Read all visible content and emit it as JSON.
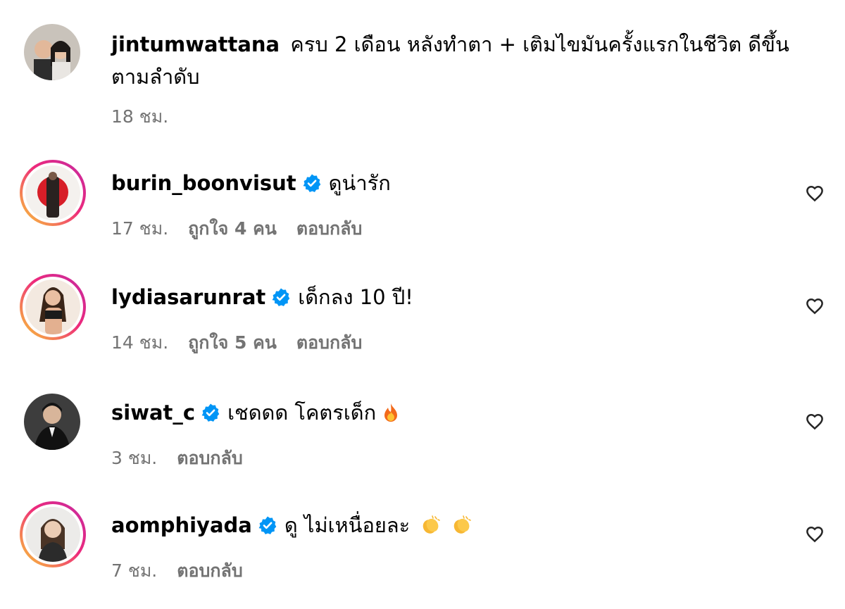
{
  "caption": {
    "username": "jintumwattana",
    "text": "ครบ 2 เดือน หลังทำตา + เติมไขมันครั้งแรกในชีวิต ดีขึ้นตามลำดับ",
    "time": "18 ชม."
  },
  "comments": [
    {
      "username": "burin_boonvisut",
      "verified": true,
      "text": "ดูน่ารัก",
      "time": "17 ชม.",
      "likes": "ถูกใจ 4 คน",
      "reply": "ตอบกลับ",
      "emoji": []
    },
    {
      "username": "lydiasarunrat",
      "verified": true,
      "text": "เด็กลง 10 ปี!",
      "time": "14 ชม.",
      "likes": "ถูกใจ 5 คน",
      "reply": "ตอบกลับ",
      "emoji": []
    },
    {
      "username": "siwat_c",
      "verified": true,
      "text": "เชดดด โคตรเด็ก",
      "time": "3 ชม.",
      "likes": "",
      "reply": "ตอบกลับ",
      "emoji": [
        "fire-emoji"
      ]
    },
    {
      "username": "aomphiyada",
      "verified": true,
      "text": "ดู ไม่เหนื่อยละ",
      "time": "7 ชม.",
      "likes": "",
      "reply": "ตอบกลับ",
      "emoji": [
        "clapping-hands-emoji",
        "clapping-hands-emoji"
      ]
    }
  ],
  "icons": {
    "verified": "verified-badge-icon",
    "like": "heart-outline-icon"
  },
  "colors": {
    "verified_blue": "#0095f6",
    "meta_gray": "#737373",
    "story_ring_start": "#f9ce34",
    "story_ring_end": "#c32aa3"
  }
}
